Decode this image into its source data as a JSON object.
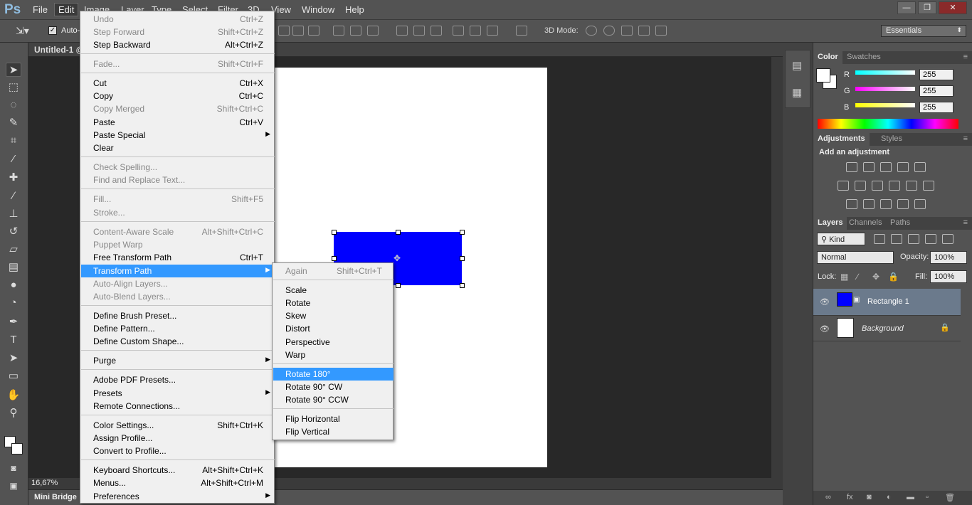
{
  "app": {
    "logo": "Ps"
  },
  "menubar": {
    "items": [
      "File",
      "Edit",
      "Image",
      "Layer",
      "Type",
      "Select",
      "Filter",
      "3D",
      "View",
      "Window",
      "Help"
    ]
  },
  "window_controls": {
    "minimize": "—",
    "restore": "❐",
    "close": "✕"
  },
  "options_bar": {
    "auto_select": "Auto-",
    "mode_3d": "3D Mode:",
    "workspace": "Essentials"
  },
  "document": {
    "tab_title": "Untitled-1 @",
    "zoom": "16,67%",
    "shape_color": "#0000ff"
  },
  "bottom_panel": {
    "mini_bridge": "Mini Bridge"
  },
  "edit_menu": {
    "items": [
      {
        "label": "Undo",
        "shortcut": "Ctrl+Z",
        "disabled": true
      },
      {
        "label": "Step Forward",
        "shortcut": "Shift+Ctrl+Z",
        "disabled": true
      },
      {
        "label": "Step Backward",
        "shortcut": "Alt+Ctrl+Z",
        "disabled": false
      },
      {
        "label": "Fade...",
        "shortcut": "Shift+Ctrl+F",
        "disabled": true
      },
      {
        "label": "Cut",
        "shortcut": "Ctrl+X",
        "disabled": false
      },
      {
        "label": "Copy",
        "shortcut": "Ctrl+C",
        "disabled": false
      },
      {
        "label": "Copy Merged",
        "shortcut": "Shift+Ctrl+C",
        "disabled": true
      },
      {
        "label": "Paste",
        "shortcut": "Ctrl+V",
        "disabled": false
      },
      {
        "label": "Paste Special",
        "shortcut": "",
        "disabled": false,
        "submenu": true
      },
      {
        "label": "Clear",
        "shortcut": "",
        "disabled": false
      },
      {
        "label": "Check Spelling...",
        "shortcut": "",
        "disabled": true
      },
      {
        "label": "Find and Replace Text...",
        "shortcut": "",
        "disabled": true
      },
      {
        "label": "Fill...",
        "shortcut": "Shift+F5",
        "disabled": true
      },
      {
        "label": "Stroke...",
        "shortcut": "",
        "disabled": true
      },
      {
        "label": "Content-Aware Scale",
        "shortcut": "Alt+Shift+Ctrl+C",
        "disabled": true
      },
      {
        "label": "Puppet Warp",
        "shortcut": "",
        "disabled": true
      },
      {
        "label": "Free Transform Path",
        "shortcut": "Ctrl+T",
        "disabled": false
      },
      {
        "label": "Transform Path",
        "shortcut": "",
        "disabled": false,
        "submenu": true,
        "highlighted": true
      },
      {
        "label": "Auto-Align Layers...",
        "shortcut": "",
        "disabled": true
      },
      {
        "label": "Auto-Blend Layers...",
        "shortcut": "",
        "disabled": true
      },
      {
        "label": "Define Brush Preset...",
        "shortcut": "",
        "disabled": false
      },
      {
        "label": "Define Pattern...",
        "shortcut": "",
        "disabled": false
      },
      {
        "label": "Define Custom Shape...",
        "shortcut": "",
        "disabled": false
      },
      {
        "label": "Purge",
        "shortcut": "",
        "disabled": false,
        "submenu": true
      },
      {
        "label": "Adobe PDF Presets...",
        "shortcut": "",
        "disabled": false
      },
      {
        "label": "Presets",
        "shortcut": "",
        "disabled": false,
        "submenu": true
      },
      {
        "label": "Remote Connections...",
        "shortcut": "",
        "disabled": false
      },
      {
        "label": "Color Settings...",
        "shortcut": "Shift+Ctrl+K",
        "disabled": false
      },
      {
        "label": "Assign Profile...",
        "shortcut": "",
        "disabled": false
      },
      {
        "label": "Convert to Profile...",
        "shortcut": "",
        "disabled": false
      },
      {
        "label": "Keyboard Shortcuts...",
        "shortcut": "Alt+Shift+Ctrl+K",
        "disabled": false
      },
      {
        "label": "Menus...",
        "shortcut": "Alt+Shift+Ctrl+M",
        "disabled": false
      },
      {
        "label": "Preferences",
        "shortcut": "",
        "disabled": false,
        "submenu": true
      }
    ]
  },
  "transform_submenu": {
    "items": [
      {
        "label": "Again",
        "shortcut": "Shift+Ctrl+T",
        "disabled": true
      },
      {
        "label": "Scale",
        "shortcut": "",
        "disabled": false
      },
      {
        "label": "Rotate",
        "shortcut": "",
        "disabled": false
      },
      {
        "label": "Skew",
        "shortcut": "",
        "disabled": false
      },
      {
        "label": "Distort",
        "shortcut": "",
        "disabled": false
      },
      {
        "label": "Perspective",
        "shortcut": "",
        "disabled": false
      },
      {
        "label": "Warp",
        "shortcut": "",
        "disabled": false
      },
      {
        "label": "Rotate 180°",
        "shortcut": "",
        "disabled": false,
        "highlighted": true
      },
      {
        "label": "Rotate 90° CW",
        "shortcut": "",
        "disabled": false
      },
      {
        "label": "Rotate 90° CCW",
        "shortcut": "",
        "disabled": false
      },
      {
        "label": "Flip Horizontal",
        "shortcut": "",
        "disabled": false
      },
      {
        "label": "Flip Vertical",
        "shortcut": "",
        "disabled": false
      }
    ]
  },
  "color_panel": {
    "tabs": [
      "Color",
      "Swatches"
    ],
    "channels": [
      {
        "name": "R",
        "value": "255"
      },
      {
        "name": "G",
        "value": "255"
      },
      {
        "name": "B",
        "value": "255"
      }
    ]
  },
  "adjustments_panel": {
    "tabs": [
      "Adjustments",
      "Styles"
    ],
    "heading": "Add an adjustment"
  },
  "layers_panel": {
    "tabs": [
      "Layers",
      "Channels",
      "Paths"
    ],
    "filter": "Kind",
    "blend_mode": "Normal",
    "opacity_label": "Opacity:",
    "opacity": "100%",
    "lock_label": "Lock:",
    "fill_label": "Fill:",
    "fill": "100%",
    "layers": [
      {
        "name": "Rectangle 1",
        "selected": true
      },
      {
        "name": "Background",
        "selected": false
      }
    ]
  }
}
